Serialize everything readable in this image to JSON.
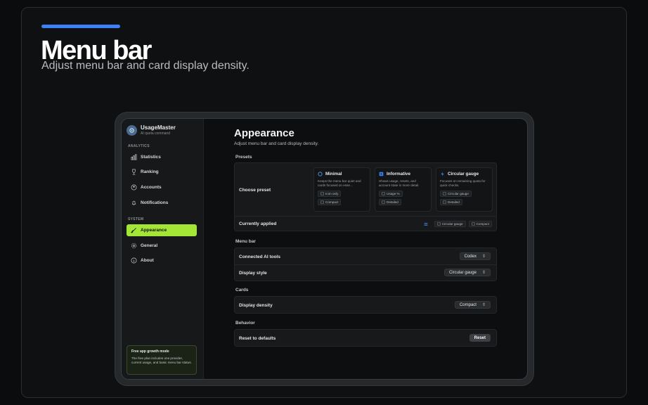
{
  "hero": {
    "title": "Menu bar",
    "subtitle": "Adjust menu bar and card display density."
  },
  "sidebar": {
    "app_name": "UsageMaster",
    "app_subtitle": "AI quota command",
    "section_analytics": "ANALYTICS",
    "section_system": "SYSTEM",
    "items": [
      {
        "label": "Statistics",
        "icon": "bar-chart-icon"
      },
      {
        "label": "Ranking",
        "icon": "trophy-icon"
      },
      {
        "label": "Accounts",
        "icon": "user-circle-icon"
      },
      {
        "label": "Notifications",
        "icon": "bell-icon"
      },
      {
        "label": "Appearance",
        "icon": "brush-icon",
        "active": true
      },
      {
        "label": "General",
        "icon": "gear-icon"
      },
      {
        "label": "About",
        "icon": "info-icon"
      }
    ],
    "promo": {
      "title": "Free app growth mode",
      "body": "The free plan includes one provider, current usage, and basic menu bar status."
    }
  },
  "main": {
    "title": "Appearance",
    "subtitle": "Adjust menu bar and card display density.",
    "presets_label": "Presets",
    "choose_preset_label": "Choose preset",
    "presets": [
      {
        "name": "Minimal",
        "icon": "circle-icon",
        "desc": "Keeps the menu bar quiet and cards focused on esse...",
        "chips": [
          "Icon only",
          "Compact"
        ]
      },
      {
        "name": "Informative",
        "icon": "list-icon",
        "desc": "Shows usage, resets, and account state in more detail.",
        "chips": [
          "Usage %",
          "Detailed"
        ]
      },
      {
        "name": "Circular gauge",
        "icon": "bolt-icon",
        "desc": "Focuses on remaining quota for quick checks.",
        "chips": [
          "Circular gauge",
          "Detailed"
        ]
      }
    ],
    "currently_applied_label": "Currently applied",
    "currently_applied_chips": [
      "Circular gauge",
      "Compact"
    ],
    "menu_bar_label": "Menu bar",
    "connected_tools_label": "Connected AI tools",
    "connected_tools_value": "Codex",
    "display_style_label": "Display style",
    "display_style_value": "Circular gauge",
    "cards_label": "Cards",
    "display_density_label": "Display density",
    "display_density_value": "Compact",
    "behavior_label": "Behavior",
    "reset_defaults_label": "Reset to defaults",
    "reset_button": "Reset"
  },
  "colors": {
    "accent_blue": "#3b82f6",
    "active_green": "#a3e635"
  }
}
